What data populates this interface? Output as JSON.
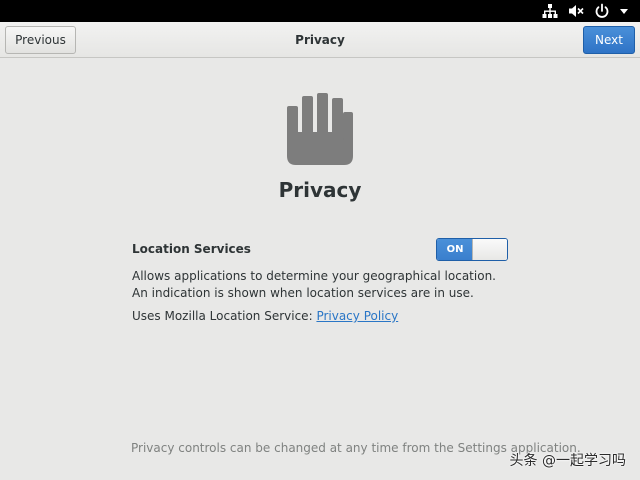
{
  "system_tray": {
    "icons": [
      "network-icon",
      "volume-muted-icon",
      "power-icon",
      "chevron-down-icon"
    ]
  },
  "header": {
    "title": "Privacy",
    "previous_label": "Previous",
    "next_label": "Next"
  },
  "main": {
    "hero_icon": "hand-icon",
    "heading": "Privacy",
    "location_services": {
      "label": "Location Services",
      "toggle_state": "ON",
      "description": "Allows applications to determine your geographical location. An indication is shown when location services are in use.",
      "mozilla_text": "Uses Mozilla Location Service:",
      "privacy_policy_link": "Privacy Policy"
    }
  },
  "footer": {
    "note": "Privacy controls can be changed at any time from the Settings application.",
    "watermark": "头条 @一起学习吗"
  },
  "colors": {
    "accent": "#3a7fcd",
    "link": "#2a76c6",
    "background": "#e8e8e7",
    "topbar": "#000000"
  }
}
